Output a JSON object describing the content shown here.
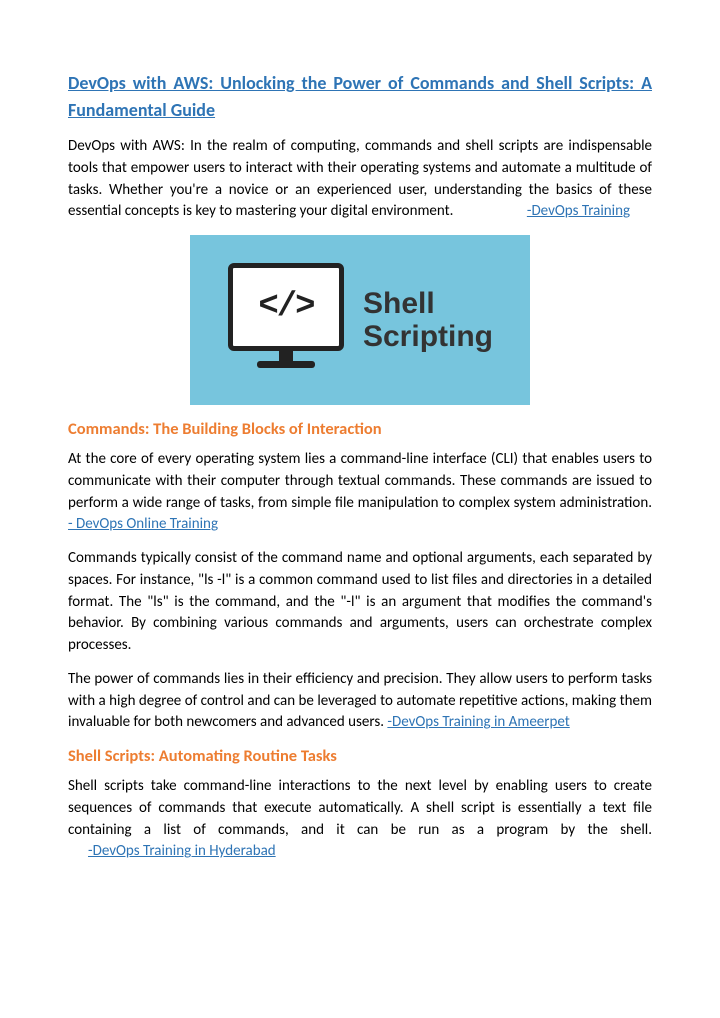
{
  "title": "DevOps with AWS: Unlocking the Power of Commands and Shell Scripts: A Fundamental Guide",
  "intro": {
    "text": "DevOps with AWS: In the realm of computing, commands and shell scripts are indispensable tools that empower users to interact with their operating systems and automate a multitude of tasks. Whether you're a novice or an experienced user, understanding the basics of these essential concepts is key to mastering your digital environment.",
    "link": "-DevOps Training"
  },
  "image": {
    "code_symbol": "</>",
    "line1": "Shell",
    "line2": "Scripting"
  },
  "section1": {
    "heading": "Commands: The Building Blocks of Interaction",
    "para1_text": "At the core of every operating system lies a command-line interface (CLI) that enables users to communicate with their computer through textual commands. These commands are issued to perform a wide range of tasks, from simple file manipulation to complex system administration.",
    "para1_link": "- DevOps Online Training",
    "para2": "Commands typically consist of the command name and optional arguments, each separated by spaces. For instance, \"ls -l\" is a common command used to list files and directories in a detailed format. The \"ls\" is the command, and the \"-l\" is an argument that modifies the command's behavior. By combining various commands and arguments, users can orchestrate complex processes.",
    "para3_text": "The power of commands lies in their efficiency and precision. They allow users to perform tasks with a high degree of control and can be leveraged to automate repetitive actions, making them invaluable for both newcomers and advanced users. ",
    "para3_link": "-DevOps Training in Ameerpet"
  },
  "section2": {
    "heading": "Shell Scripts: Automating Routine Tasks",
    "para1_text": "Shell scripts take command-line interactions to the next level by enabling users to create sequences of commands that execute automatically. A shell script is essentially a text file containing a list of commands, and it can be run as a program by the shell.",
    "para1_link": "-DevOps Training in Hyderabad"
  }
}
